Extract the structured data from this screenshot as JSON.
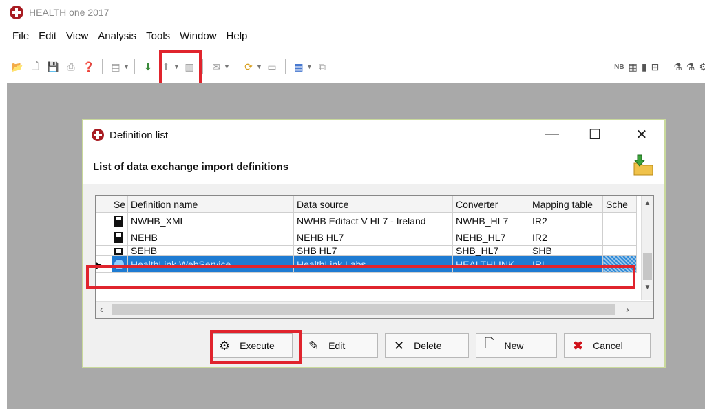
{
  "app": {
    "title": "HEALTH one 2017"
  },
  "menu": [
    "File",
    "Edit",
    "View",
    "Analysis",
    "Tools",
    "Window",
    "Help"
  ],
  "toolbar_right": {
    "nb_label": "NB"
  },
  "dialog": {
    "title": "Definition list",
    "heading": "List of data exchange import definitions",
    "controls": {
      "minimize": "—",
      "maximize": "☐",
      "close": "✕"
    }
  },
  "table": {
    "columns": [
      "Se",
      "Definition name",
      "Data source",
      "Converter",
      "Mapping table",
      "Sche"
    ],
    "rows": [
      {
        "name": "NWHB_XML",
        "source": "NWHB Edifact V HL7 - Ireland",
        "converter": "NWHB_HL7",
        "mapping": "IR2"
      },
      {
        "name": "NEHB",
        "source": "NEHB HL7",
        "converter": "NEHB_HL7",
        "mapping": "IR2"
      },
      {
        "name": "SEHB",
        "source": "SHB HL7",
        "converter": "SHB_HL7",
        "mapping": "SHB"
      },
      {
        "name": "HealthLink WebService",
        "source": "HealthLink Labs",
        "converter": "HEALTHLINK",
        "mapping": "IRL"
      }
    ]
  },
  "buttons": {
    "execute": "Execute",
    "edit": "Edit",
    "delete": "Delete",
    "new": "New",
    "cancel": "Cancel"
  },
  "colors": {
    "highlight": "#e0242d",
    "selection": "#1e7bd2",
    "brand": "#a81c22"
  }
}
